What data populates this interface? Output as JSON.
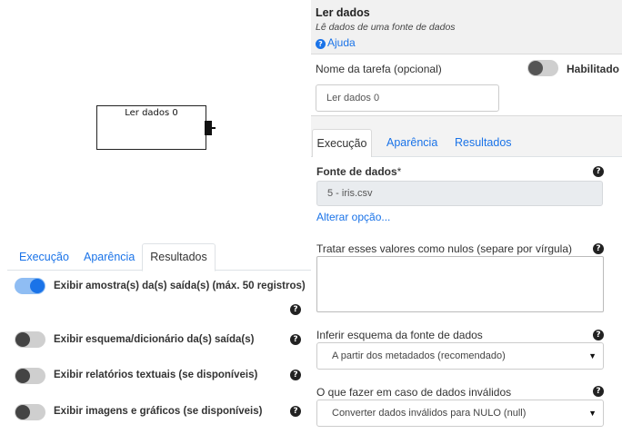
{
  "canvas": {
    "node_label": "Ler dados 0"
  },
  "left_panel": {
    "tabs": [
      {
        "label": "Execução",
        "active": false
      },
      {
        "label": "Aparência",
        "active": false
      },
      {
        "label": "Resultados",
        "active": true
      }
    ],
    "options": [
      {
        "label": "Exibir amostra(s) da(s) saída(s) (máx. 50 registros)",
        "enabled": true
      },
      {
        "label": "Exibir esquema/dicionário da(s) saída(s)",
        "enabled": false
      },
      {
        "label": "Exibir relatórios textuais (se disponíveis)",
        "enabled": false
      },
      {
        "label": "Exibir imagens e gráficos (se disponíveis)",
        "enabled": false
      }
    ]
  },
  "right_panel": {
    "title": "Ler dados",
    "subtitle": "Lê dados de uma fonte de dados",
    "help_link": "Ajuda",
    "task_name_label": "Nome da tarefa (opcional)",
    "task_name_value": "Ler dados 0",
    "enabled_label": "Habilitado",
    "enabled": false,
    "tabs": [
      {
        "label": "Execução",
        "active": true
      },
      {
        "label": "Aparência",
        "active": false
      },
      {
        "label": "Resultados",
        "active": false
      }
    ],
    "data_source_label": "Fonte de dados",
    "required_mark": "*",
    "data_source_value": "5 - iris.csv",
    "change_option_link": "Alterar opção...",
    "nulls_label": "Tratar esses valores como nulos (separe por vírgula)",
    "nulls_value": "",
    "infer_schema_label": "Inferir esquema da fonte de dados",
    "infer_schema_value": "A partir dos metadados (recomendado)",
    "invalid_data_label": "O que fazer em caso de dados inválidos",
    "invalid_data_value": "Converter dados inválidos para NULO (null)",
    "help_glyph": "?",
    "dropdown_glyph": "▼"
  }
}
